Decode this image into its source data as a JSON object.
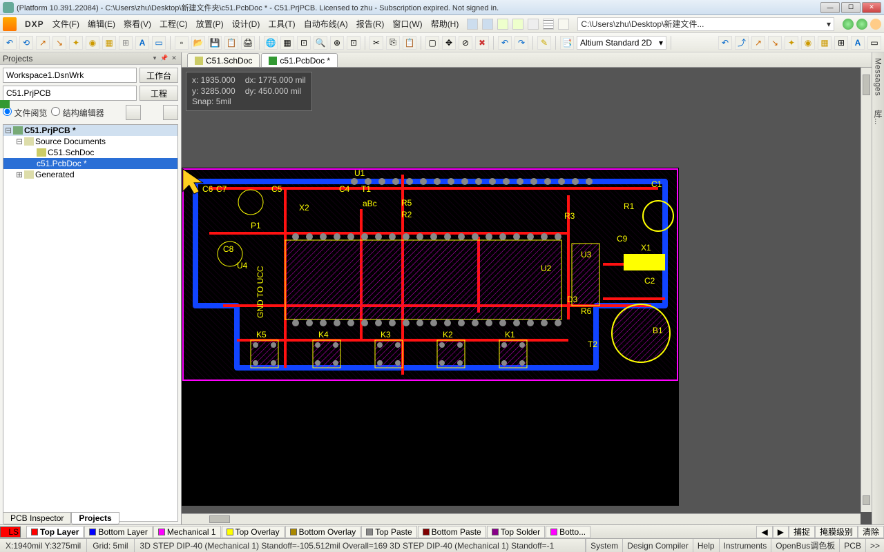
{
  "title": "(Platform 10.391.22084) - C:\\Users\\zhu\\Desktop\\新建文件夹\\c51.PcbDoc * - C51.PrjPCB. Licensed to zhu - Subscription expired. Not signed in.",
  "dxp": "DXP",
  "menus": [
    "文件(F)",
    "编辑(E)",
    "察看(V)",
    "工程(C)",
    "放置(P)",
    "设计(D)",
    "工具(T)",
    "自动布线(A)",
    "报告(R)",
    "窗口(W)",
    "帮助(H)"
  ],
  "navpath": "C:\\Users\\zhu\\Desktop\\新建文件...",
  "viewCombo": "Altium Standard 2D",
  "projects": {
    "title": "Projects",
    "workspace": "Workspace1.DsnWrk",
    "workspaceBtn": "工作台",
    "project": "C51.PrjPCB",
    "projectBtn": "工程",
    "radio1": "文件阅览",
    "radio2": "结构编辑器",
    "tree": {
      "root": "C51.PrjPCB *",
      "src": "Source Documents",
      "sch": "C51.SchDoc",
      "pcb": "c51.PcbDoc *",
      "gen": "Generated"
    }
  },
  "tabs": {
    "sch": "C51.SchDoc",
    "pcb": "c51.PcbDoc *"
  },
  "hud": {
    "x": "x: 1935.000",
    "dx": "dx: 1775.000 mil",
    "y": "y: 3285.000",
    "dy": "dy:  450.000  mil",
    "snap": "Snap: 5mil"
  },
  "designators": {
    "u1": "U1",
    "c1": "C1",
    "c2": "C2",
    "c4": "C4",
    "c5": "C5",
    "c6": "C6",
    "c7": "C7",
    "c8": "C8",
    "c9": "C9",
    "r1": "R1",
    "r2": "R2",
    "r3": "R3",
    "r5": "R5",
    "r6": "R6",
    "p1": "P1",
    "x1": "X1",
    "x2": "X2",
    "t1": "T1",
    "t2": "T2",
    "u2": "U2",
    "u3": "U3",
    "u4": "U4",
    "b1": "B1",
    "d3": "D3",
    "k1": "K1",
    "k2": "K2",
    "k3": "K3",
    "k4": "K4",
    "k5": "K5",
    "abc": "aBc",
    "gnd": "GND TO UCC"
  },
  "bottomPanelTabs": {
    "inspector": "PCB Inspector",
    "projects": "Projects"
  },
  "layers": {
    "ls": "LS",
    "top": "Top Layer",
    "bottom": "Bottom Layer",
    "mech1": "Mechanical 1",
    "topOverlay": "Top Overlay",
    "botOverlay": "Bottom Overlay",
    "topPaste": "Top Paste",
    "botPaste": "Bottom Paste",
    "topSolder": "Top Solder",
    "botSolder": "Botto..."
  },
  "layerTail": [
    "捕捉",
    "掩膜级别",
    "清除"
  ],
  "status": {
    "coord": "X:1940mil Y:3275mil",
    "grid": "Grid: 5mil",
    "info": "3D STEP DIP-40 (Mechanical 1)   Standoff=-105.512mil   Overall=169   3D STEP DIP-40 (Mechanical 1)   Standoff=-1"
  },
  "statusBtns": [
    "System",
    "Design Compiler",
    "Help",
    "Instruments",
    "OpenBus调色板",
    "PCB",
    ">>"
  ],
  "sideTabs": [
    "Messages",
    "库..."
  ]
}
